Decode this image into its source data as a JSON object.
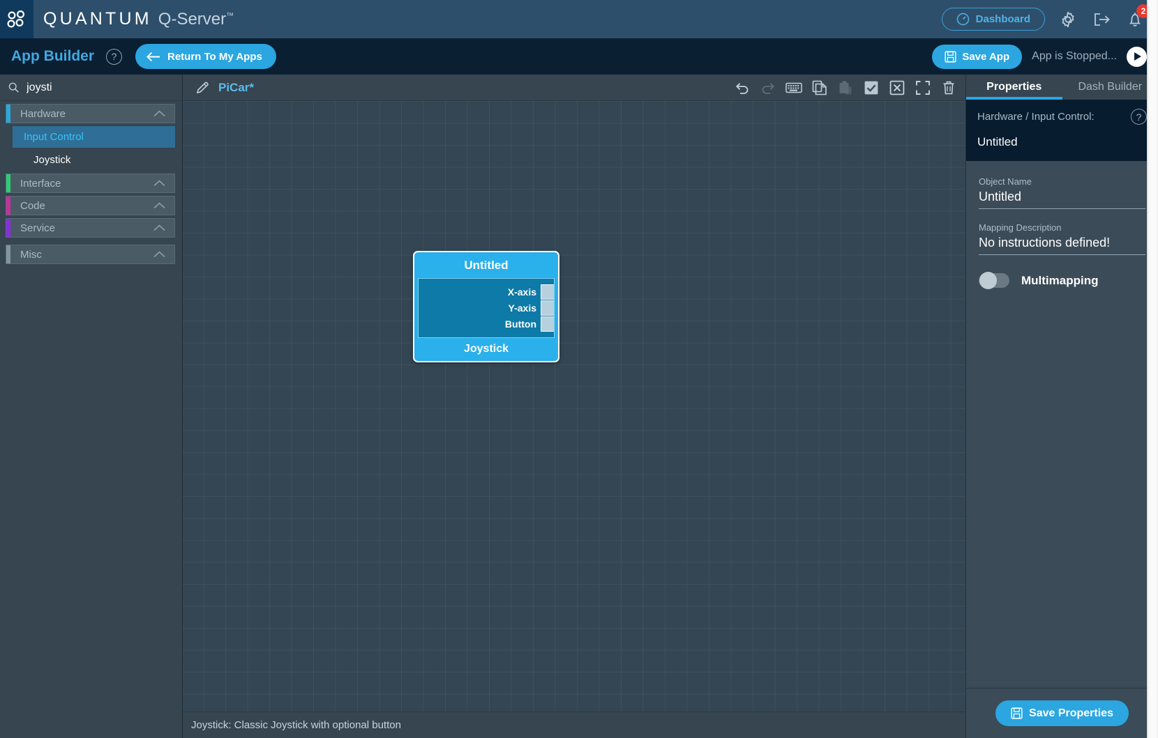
{
  "brand": {
    "logo_icon": "molecule-logo-icon",
    "name": "QUANTUM",
    "product": "Q-Server",
    "tm": "™",
    "dashboard_label": "Dashboard",
    "dashboard_icon": "gauge-icon",
    "settings_icon": "gear-icon",
    "logout_icon": "logout-icon",
    "notifications_icon": "bell-icon",
    "notifications_count": "2",
    "accent": "#2ba6e0",
    "badge_color": "#e8392e"
  },
  "appbar": {
    "title": "App Builder",
    "help_icon": "question-mark-icon",
    "help_label": "?",
    "return_label": "Return To My Apps",
    "return_icon": "arrow-left-icon",
    "save_label": "Save App",
    "save_icon": "floppy-disk-icon",
    "status": "App is Stopped...",
    "play_icon": "play-icon"
  },
  "sidebar": {
    "search": {
      "value": "joysti",
      "placeholder": "Search",
      "icon": "search-icon"
    },
    "categories": [
      {
        "label": "Hardware",
        "accent": "#29a8dd",
        "chevron": "chevron-up-icon",
        "children": [
          {
            "label": "Input Control",
            "type": "group",
            "selected": true
          },
          {
            "label": "Joystick",
            "type": "leaf",
            "selected": false
          }
        ]
      },
      {
        "label": "Interface",
        "accent": "#2ecc71",
        "chevron": "chevron-up-icon",
        "children": []
      },
      {
        "label": "Code",
        "accent": "#c4319b",
        "chevron": "chevron-up-icon",
        "children": []
      },
      {
        "label": "Service",
        "accent": "#8a2be2",
        "chevron": "chevron-up-icon",
        "children": []
      },
      {
        "label": "Misc",
        "accent": "#8295a3",
        "chevron": "chevron-up-icon",
        "children": []
      }
    ]
  },
  "canvas": {
    "edit_icon": "pencil-icon",
    "title": "PiCar*",
    "tools": [
      {
        "name": "undo-icon",
        "disabled": false
      },
      {
        "name": "redo-icon",
        "disabled": true
      },
      {
        "name": "keyboard-icon",
        "disabled": false
      },
      {
        "name": "copy-icon",
        "disabled": false
      },
      {
        "name": "paste-icon",
        "disabled": true
      },
      {
        "name": "select-all-icon",
        "disabled": false
      },
      {
        "name": "deselect-icon",
        "disabled": false
      },
      {
        "name": "fullscreen-icon",
        "disabled": false
      },
      {
        "name": "trash-icon",
        "disabled": false
      }
    ],
    "node": {
      "title": "Untitled",
      "type_label": "Joystick",
      "ports": [
        "X-axis",
        "Y-axis",
        "Button"
      ],
      "header_color": "#2ab0ea",
      "body_color": "#0d7aa8"
    },
    "status_text": "Joystick: Classic Joystick with optional button"
  },
  "properties": {
    "tabs": [
      {
        "label": "Properties",
        "active": true
      },
      {
        "label": "Dash Builder",
        "active": false
      }
    ],
    "context": {
      "path": "Hardware / Input Control:",
      "name": "Untitled",
      "help_icon": "question-mark-icon",
      "help_label": "?"
    },
    "fields": [
      {
        "label": "Object Name",
        "value": "Untitled"
      },
      {
        "label": "Mapping Description",
        "value": "No instructions defined!"
      }
    ],
    "toggle": {
      "label": "Multimapping",
      "on": false
    },
    "save_label": "Save Properties",
    "save_icon": "floppy-disk-icon"
  }
}
